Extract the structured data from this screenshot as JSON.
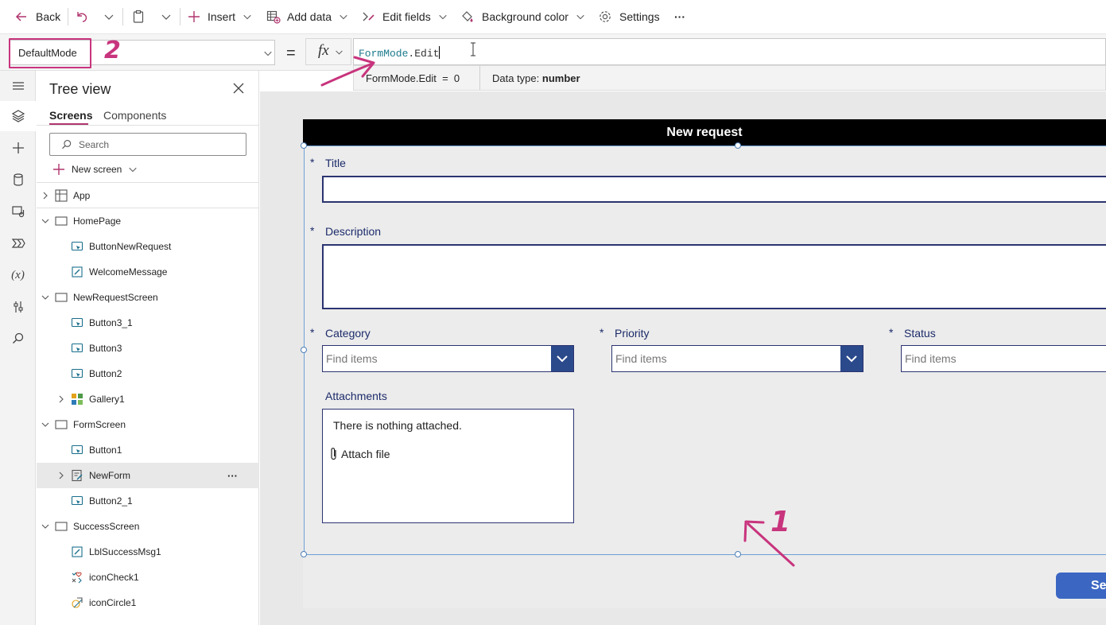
{
  "toolbar": {
    "back": "Back",
    "insert": "Insert",
    "add_data": "Add data",
    "edit_fields": "Edit fields",
    "background_color": "Background color",
    "settings": "Settings",
    "more": "···"
  },
  "formula_bar": {
    "property": "DefaultMode",
    "equals": "=",
    "fx": "fx",
    "formula_part1": "FormMode",
    "formula_part2": ".Edit",
    "tooltip_expr": "FormMode.Edit  =  0",
    "tooltip_type_label": "Data type:",
    "tooltip_type_value": "number"
  },
  "tree": {
    "title": "Tree view",
    "tabs": [
      "Screens",
      "Components"
    ],
    "search_placeholder": "Search",
    "new_screen": "New screen",
    "nodes": [
      {
        "label": "App"
      },
      {
        "label": "HomePage"
      },
      {
        "label": "ButtonNewRequest"
      },
      {
        "label": "WelcomeMessage"
      },
      {
        "label": "NewRequestScreen"
      },
      {
        "label": "Button3_1"
      },
      {
        "label": "Button3"
      },
      {
        "label": "Button2"
      },
      {
        "label": "Gallery1"
      },
      {
        "label": "FormScreen"
      },
      {
        "label": "Button1"
      },
      {
        "label": "NewForm"
      },
      {
        "label": "Button2_1"
      },
      {
        "label": "SuccessScreen"
      },
      {
        "label": "LblSuccessMsg1"
      },
      {
        "label": "iconCheck1"
      },
      {
        "label": "iconCircle1"
      }
    ],
    "selected_more": "···"
  },
  "form": {
    "header": "New request",
    "required_mark": "*",
    "title_label": "Title",
    "description_label": "Description",
    "category_label": "Category",
    "priority_label": "Priority",
    "status_label": "Status",
    "find_items": "Find items",
    "attachments_label": "Attachments",
    "nothing_attached": "There is nothing attached.",
    "attach_file": "Attach file",
    "submit_partial": "Se"
  },
  "annotations": {
    "mark_1": "1",
    "mark_2": "2",
    "color": "#c8347d"
  }
}
